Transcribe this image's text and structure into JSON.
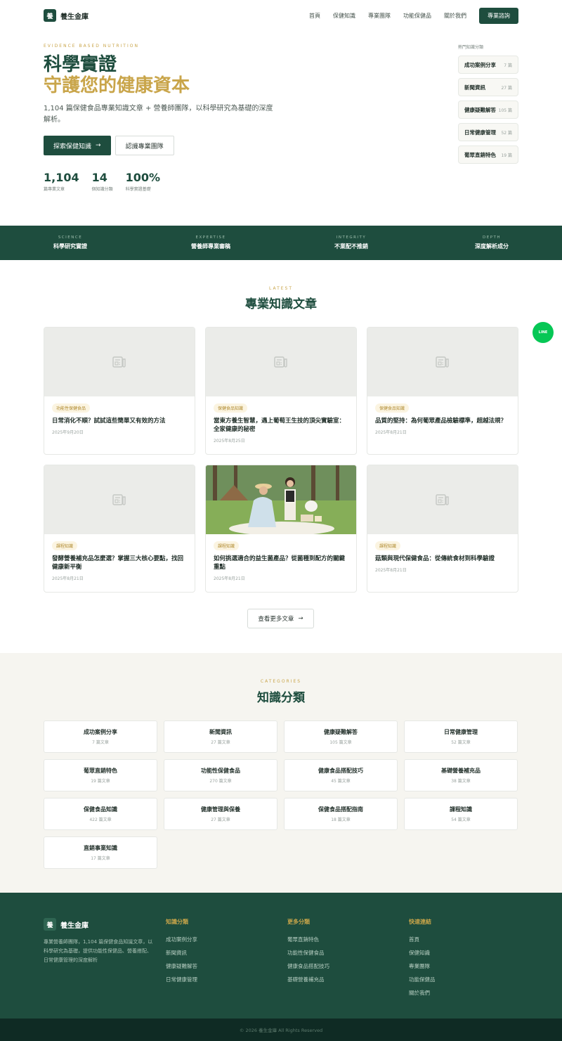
{
  "brand": {
    "mark": "養",
    "name": "養生金庫"
  },
  "nav": {
    "links": [
      "首頁",
      "保健知識",
      "專業團隊",
      "功能保健品",
      "關於我們"
    ],
    "cta": "專業諮詢"
  },
  "hero": {
    "eyebrow": "EVIDENCE BASED NUTRITION",
    "title_line1": "科學實證",
    "title_line2": "守護您的健康資本",
    "description": "1,104 篇保健食品專業知識文章 + 營養師團隊，以科學研究為基礎的深度解析。",
    "primary_button": "探索保健知識",
    "secondary_button": "認識專業團隊",
    "stats": [
      {
        "value": "1,104",
        "label": "篇專業文章"
      },
      {
        "value": "14",
        "label": "個知識分類"
      },
      {
        "value": "100%",
        "label": "科學實證基礎"
      }
    ]
  },
  "hot_categories": {
    "title": "熱門知識分類",
    "items": [
      {
        "name": "成功案例分享",
        "count": "7 篇"
      },
      {
        "name": "新聞資訊",
        "count": "27 篇"
      },
      {
        "name": "健康疑難解答",
        "count": "105 篇"
      },
      {
        "name": "日常健康管理",
        "count": "52 篇"
      },
      {
        "name": "葡眾直銷特色",
        "count": "19 篇"
      }
    ]
  },
  "band": [
    {
      "en": "SCIENCE",
      "zh": "科學研究實證"
    },
    {
      "en": "EXPERTISE",
      "zh": "營養師專業審稿"
    },
    {
      "en": "INTEGRITY",
      "zh": "不業配不推銷"
    },
    {
      "en": "DEPTH",
      "zh": "深度解析成分"
    }
  ],
  "articles_section": {
    "eyebrow": "LATEST",
    "title": "專業知識文章",
    "more_button": "查看更多文章",
    "articles": [
      {
        "tag": "功能性保健食品",
        "title": "日常消化不順？試試這些簡單又有效的方法",
        "date": "2025年9月20日",
        "photo": false
      },
      {
        "tag": "保健食品知識",
        "title": "當東方養生智慧，遇上葡萄王生技的頂尖實驗室：全家健康的秘密",
        "date": "2025年8月25日",
        "photo": false
      },
      {
        "tag": "保健食品知識",
        "title": "品質的堅持：為何葡眾產品檢驗標準，超越法規？",
        "date": "2025年8月21日",
        "photo": false
      },
      {
        "tag": "課程知識",
        "title": "發酵營養補充品怎麼選？掌握三大核心要點，找回健康新平衡",
        "date": "2025年8月21日",
        "photo": false
      },
      {
        "tag": "課程知識",
        "title": "如何挑選適合的益生菌產品？從菌種到配方的關鍵重點",
        "date": "2025年8月21日",
        "photo": true
      },
      {
        "tag": "課程知識",
        "title": "菇類與現代保健食品：從傳統食材到科學驗證",
        "date": "2025年8月21日",
        "photo": false
      }
    ]
  },
  "line_button": "LINE",
  "categories_section": {
    "eyebrow": "CATEGORIES",
    "title": "知識分類",
    "items": [
      {
        "name": "成功案例分享",
        "count": "7 篇文章"
      },
      {
        "name": "新聞資訊",
        "count": "27 篇文章"
      },
      {
        "name": "健康疑難解答",
        "count": "105 篇文章"
      },
      {
        "name": "日常健康管理",
        "count": "52 篇文章"
      },
      {
        "name": "葡眾直銷特色",
        "count": "19 篇文章"
      },
      {
        "name": "功能性保健食品",
        "count": "270 篇文章"
      },
      {
        "name": "健康食品搭配技巧",
        "count": "45 篇文章"
      },
      {
        "name": "基礎營養補充品",
        "count": "38 篇文章"
      },
      {
        "name": "保健食品知識",
        "count": "422 篇文章"
      },
      {
        "name": "健康管理與保養",
        "count": "27 篇文章"
      },
      {
        "name": "保健食品搭配指南",
        "count": "18 篇文章"
      },
      {
        "name": "課程知識",
        "count": "54 篇文章"
      },
      {
        "name": "直銷事業知識",
        "count": "17 篇文章"
      }
    ]
  },
  "footer": {
    "description": "專業營養師團隊，1,104 篇保健食品知識文章，以科學研究為基礎，提供功能性保健品、營養搭配、日常健康管理的深度解析",
    "columns": [
      {
        "title": "知識分類",
        "links": [
          "成功案例分享",
          "新聞資訊",
          "健康疑難解答",
          "日常健康管理"
        ]
      },
      {
        "title": "更多分類",
        "links": [
          "葡眾直銷特色",
          "功能性保健食品",
          "健康食品搭配技巧",
          "基礎營養補充品"
        ]
      },
      {
        "title": "快速連結",
        "links": [
          "首頁",
          "保健知識",
          "專業團隊",
          "功能保健品",
          "關於我們"
        ]
      }
    ],
    "copyright": "© 2026 養生金庫 All Rights Reserved"
  },
  "colors": {
    "primary": "#1e4d3e",
    "accent": "#c9a54a",
    "line": "#06c755"
  }
}
